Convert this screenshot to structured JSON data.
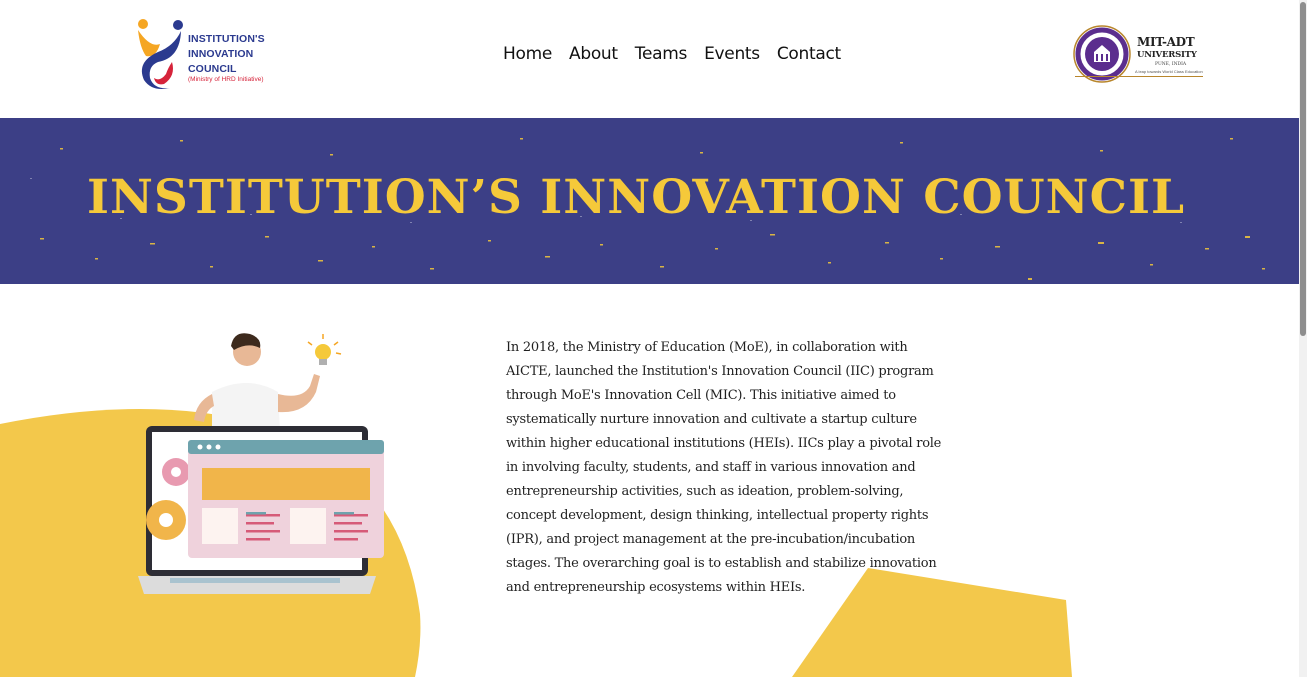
{
  "header": {
    "logo": {
      "lines": [
        "INSTITUTION'S",
        "INNOVATION",
        "COUNCIL"
      ],
      "subtitle": "(Ministry of HRD Initiative)"
    },
    "nav": [
      {
        "label": "Home"
      },
      {
        "label": "About"
      },
      {
        "label": "Teams"
      },
      {
        "label": "Events"
      },
      {
        "label": "Contact"
      }
    ],
    "partner_logo": {
      "name": "MIT-ADT",
      "university": "UNIVERSITY",
      "place": "PUNE, INDIA",
      "tagline": "A leap towards World Class Education"
    }
  },
  "banner": {
    "title": "INSTITUTION’S INNOVATION COUNCIL"
  },
  "about": {
    "paragraph": "In 2018, the Ministry of Education (MoE), in collaboration with AICTE, launched the Institution's Innovation Council (IIC) program through MoE's Innovation Cell (MIC). This initiative aimed to systematically nurture innovation and cultivate a startup culture within higher educational institutions (HEIs). IICs play a pivotal role in involving faculty, students, and staff in various innovation and entrepreneurship activities, such as ideation, problem-solving, concept development, design thinking, intellectual property rights (IPR), and project management at the pre-incubation/incubation stages. The overarching goal is to establish and stabilize innovation and entrepreneurship ecosystems within HEIs."
  },
  "colors": {
    "banner_bg": "#3c3f86",
    "banner_text": "#f5c93a",
    "accent_yellow": "#f3c84b",
    "logo_blue": "#2b3a8f",
    "logo_red": "#d6233a"
  }
}
